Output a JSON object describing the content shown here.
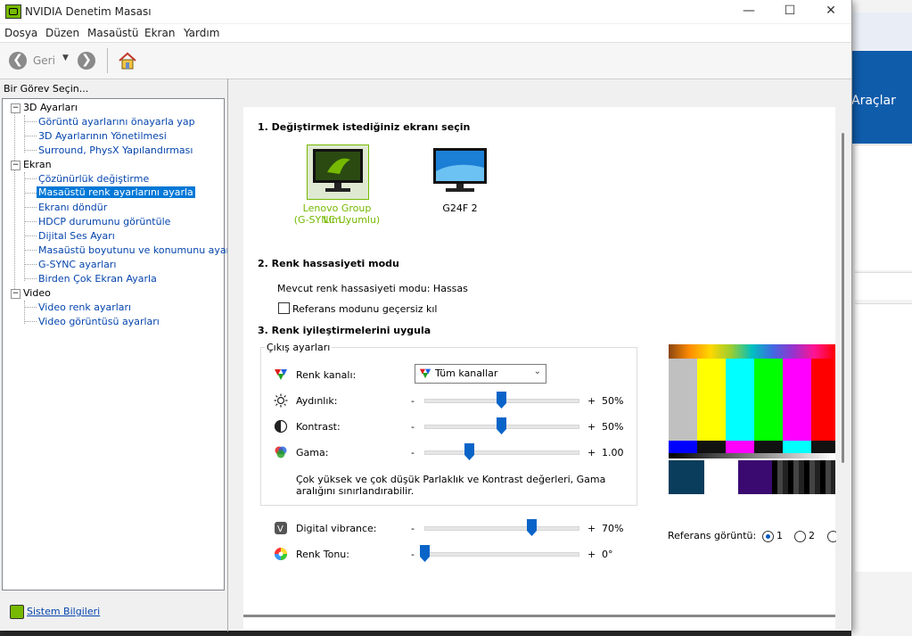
{
  "window": {
    "title": "NVIDIA Denetim Masası"
  },
  "menu": [
    "Dosya",
    "Düzen",
    "Masaüstü",
    "Ekran",
    "Yardım"
  ],
  "toolbar": {
    "back_label": "Geri"
  },
  "left": {
    "heading": "Bir Görev Seçin...",
    "tree": [
      {
        "label": "3D Ayarları",
        "type": "cat"
      },
      {
        "label": "Görüntü ayarlarını önayarla yap",
        "type": "link"
      },
      {
        "label": "3D Ayarlarının Yönetilmesi",
        "type": "link"
      },
      {
        "label": "Surround, PhysX Yapılandırması",
        "type": "link"
      },
      {
        "label": "Ekran",
        "type": "cat"
      },
      {
        "label": "Çözünürlük değiştirme",
        "type": "link"
      },
      {
        "label": "Masaüstü renk ayarlarını ayarla",
        "type": "selected"
      },
      {
        "label": "Ekranı döndür",
        "type": "link"
      },
      {
        "label": "HDCP durumunu görüntüle",
        "type": "link"
      },
      {
        "label": "Dijital Ses Ayarı",
        "type": "link"
      },
      {
        "label": "Masaüstü boyutunu ve konumunu ayarla",
        "type": "link"
      },
      {
        "label": "G-SYNC ayarları",
        "type": "link"
      },
      {
        "label": "Birden Çok Ekran Ayarla",
        "type": "link"
      },
      {
        "label": "Video",
        "type": "cat"
      },
      {
        "label": "Video renk ayarları",
        "type": "link"
      },
      {
        "label": "Video görüntüsü ayarları",
        "type": "link"
      }
    ],
    "system_info": "Sistem Bilgileri"
  },
  "main": {
    "section1": "1. Değiştirmek istediğiniz ekranı seçin",
    "monitors": [
      {
        "label": "Lenovo Group Lim...",
        "sub": "(G-SYNC Uyumlu)",
        "selected": true
      },
      {
        "label": "G24F 2",
        "sub": "",
        "selected": false
      }
    ],
    "section2": "2. Renk hassasiyeti modu",
    "current_mode": "Mevcut renk hassasiyeti modu: Hassas",
    "override_label": "Referans modunu geçersiz kıl",
    "section3": "3. Renk iyileştirmelerini uygula",
    "output_group": "Çıkış ayarları",
    "channel_label": "Renk kanalı:",
    "channel_value": "Tüm kanallar",
    "sliders": [
      {
        "label": "Aydınlık:",
        "minus": "-",
        "plus": "+",
        "value": "50%",
        "pos": 0.5
      },
      {
        "label": "Kontrast:",
        "minus": "-",
        "plus": "+",
        "value": "50%",
        "pos": 0.5
      },
      {
        "label": "Gama:",
        "minus": "-",
        "plus": "+",
        "value": "1.00",
        "pos": 0.29
      }
    ],
    "note_line1": "Çok yüksek ve çok düşük Parlaklık ve Kontrast değerleri, Gama",
    "note_line2": "aralığını sınırlandırabilir.",
    "sliders2": [
      {
        "label": "Digital vibrance:",
        "minus": "-",
        "plus": "+",
        "value": "70%",
        "pos": 0.7
      },
      {
        "label": "Renk Tonu:",
        "minus": "-",
        "plus": "+",
        "value": "0°",
        "pos": 0.0
      }
    ],
    "reference_label": "Referans görüntü:",
    "reference_options": [
      "1",
      "2"
    ],
    "reference_selected": "1"
  },
  "background": {
    "tools_label": "Araçlar"
  },
  "colors": {
    "nvidia_green": "#76b900",
    "selection_blue": "#0078d7",
    "link_blue": "#0645ad",
    "slider_blue": "#0a64c8"
  }
}
